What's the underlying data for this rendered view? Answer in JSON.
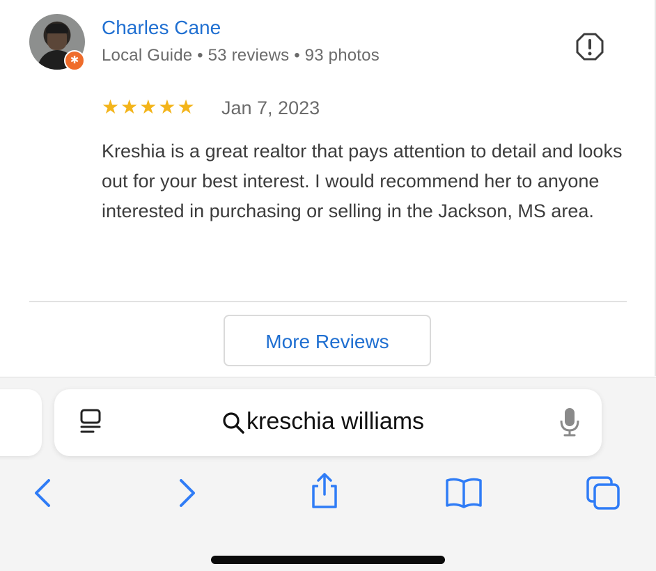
{
  "review": {
    "reviewer_name": "Charles Cane",
    "reviewer_meta": "Local Guide • 53 reviews • 93 photos",
    "rating": 5,
    "date": "Jan 7, 2023",
    "text": "Kreshia is a great realtor that pays attention to detail and looks out for your best interest. I would recommend her to anyone interested in purchasing or selling in the Jackson, MS area."
  },
  "more_reviews_label": "More Reviews",
  "browser": {
    "search_text": "kreschia williams"
  },
  "icons": {
    "report": "report-icon",
    "page_menu": "page-menu-icon",
    "search": "search-icon",
    "mic": "microphone-icon",
    "back": "back-icon",
    "forward": "forward-icon",
    "share": "share-icon",
    "bookmarks": "bookmarks-icon",
    "tabs": "tabs-icon"
  },
  "colors": {
    "link_blue": "#1f6fd1",
    "star_gold": "#f3b41a",
    "guide_badge": "#ef6c2b",
    "ios_blue": "#2f7cf6"
  }
}
